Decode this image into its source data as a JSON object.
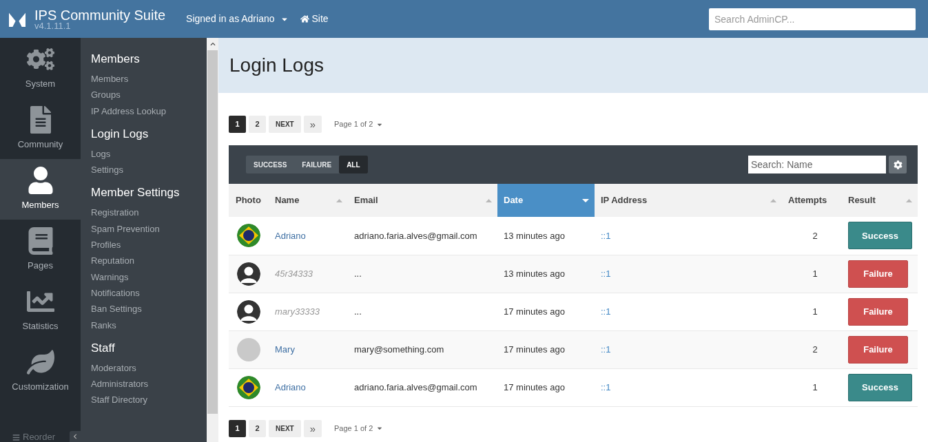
{
  "header": {
    "title": "IPS Community Suite",
    "version": "v4.1.11.1",
    "user_menu": "Signed in as Adriano",
    "site_link": "Site",
    "search": {
      "placeholder": "Search AdminCP..."
    }
  },
  "nav": [
    {
      "kind": "system",
      "label": "System",
      "selected": false
    },
    {
      "kind": "community",
      "label": "Community",
      "selected": false
    },
    {
      "kind": "members",
      "label": "Members",
      "selected": true
    },
    {
      "kind": "pages",
      "label": "Pages",
      "selected": false
    },
    {
      "kind": "statistics",
      "label": "Statistics",
      "selected": false
    },
    {
      "kind": "customization",
      "label": "Customization",
      "selected": false
    }
  ],
  "reorder": "Reorder",
  "submenu": [
    {
      "heading": "Members",
      "items": [
        "Members",
        "Groups",
        "IP Address Lookup"
      ]
    },
    {
      "heading": "Login Logs",
      "items": [
        "Logs",
        "Settings"
      ]
    },
    {
      "heading": "Member Settings",
      "items": [
        "Registration",
        "Spam Prevention",
        "Profiles",
        "Reputation",
        "Warnings",
        "Notifications",
        "Ban Settings",
        "Ranks"
      ]
    },
    {
      "heading": "Staff",
      "items": [
        "Moderators",
        "Administrators",
        "Staff Directory"
      ]
    }
  ],
  "page_title": "Login Logs",
  "pagination_top": {
    "pages": [
      {
        "label": "1",
        "selected": true
      },
      {
        "label": "2",
        "selected": false
      }
    ],
    "next": "NEXT",
    "last": "»",
    "page_of": "Page 1 of 2"
  },
  "filters": [
    {
      "label": "SUCCESS",
      "selected": false
    },
    {
      "label": "FAILURE",
      "selected": false
    },
    {
      "label": "ALL",
      "selected": true
    }
  ],
  "table_search": {
    "placeholder": "Search: Name"
  },
  "columns": [
    {
      "label": "Photo",
      "sortable": false,
      "selected": false
    },
    {
      "label": "Name",
      "sortable": true,
      "selected": false
    },
    {
      "label": "Email",
      "sortable": true,
      "selected": false
    },
    {
      "label": "Date",
      "sortable": true,
      "selected": true
    },
    {
      "label": "IP Address",
      "sortable": true,
      "selected": false
    },
    {
      "label": "Attempts",
      "sortable": false,
      "selected": false
    },
    {
      "label": "Result",
      "sortable": true,
      "selected": false
    }
  ],
  "rows": [
    {
      "avatar": {
        "kind": "flag"
      },
      "name": {
        "kind": "member",
        "text": "Adriano"
      },
      "email": "adriano.faria.alves@gmail.com",
      "date": "13 minutes ago",
      "ip": "::1",
      "attempts": "2",
      "result": {
        "kind": "success",
        "text": "Success"
      }
    },
    {
      "avatar": {
        "kind": "silhouette"
      },
      "name": {
        "kind": "unknown",
        "text": "45r34333"
      },
      "email": "...",
      "date": "13 minutes ago",
      "ip": "::1",
      "attempts": "1",
      "result": {
        "kind": "failure",
        "text": "Failure"
      }
    },
    {
      "avatar": {
        "kind": "silhouette"
      },
      "name": {
        "kind": "unknown",
        "text": "mary33333"
      },
      "email": "...",
      "date": "17 minutes ago",
      "ip": "::1",
      "attempts": "1",
      "result": {
        "kind": "failure",
        "text": "Failure"
      }
    },
    {
      "avatar": {
        "kind": "photo"
      },
      "name": {
        "kind": "member",
        "text": "Mary"
      },
      "email": "mary@something.com",
      "date": "17 minutes ago",
      "ip": "::1",
      "attempts": "2",
      "result": {
        "kind": "failure",
        "text": "Failure"
      }
    },
    {
      "avatar": {
        "kind": "flag"
      },
      "name": {
        "kind": "member",
        "text": "Adriano"
      },
      "email": "adriano.faria.alves@gmail.com",
      "date": "17 minutes ago",
      "ip": "::1",
      "attempts": "1",
      "result": {
        "kind": "success",
        "text": "Success"
      }
    }
  ],
  "pagination_bottom": {
    "pages": [
      {
        "label": "1",
        "selected": true
      },
      {
        "label": "2",
        "selected": false
      }
    ],
    "next": "NEXT",
    "last": "»",
    "page_of": "Page 1 of 2"
  }
}
